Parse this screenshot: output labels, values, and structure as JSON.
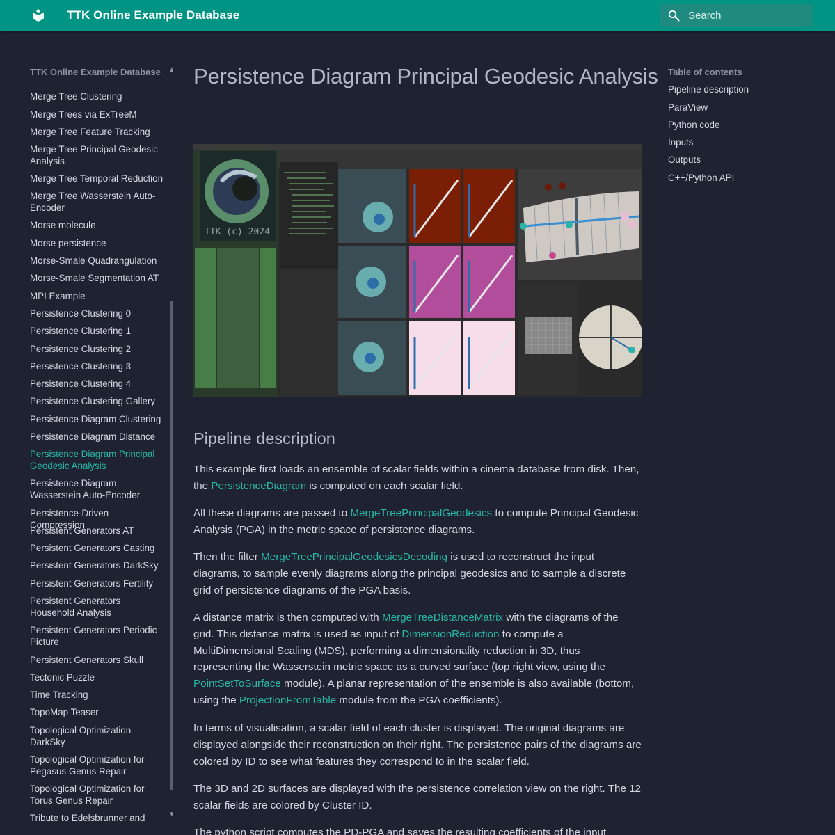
{
  "header": {
    "site_title": "TTK Online Example Database",
    "search_placeholder": "Search"
  },
  "sidebar": {
    "title": "TTK Online Example Database",
    "items": [
      {
        "label": "Merge Tree Clustering"
      },
      {
        "label": "Merge Trees via ExTreeM"
      },
      {
        "label": "Merge Tree Feature Tracking"
      },
      {
        "label": "Merge Tree Principal Geodesic Analysis"
      },
      {
        "label": "Merge Tree Temporal Reduction"
      },
      {
        "label": "Merge Tree Wasserstein Auto-Encoder"
      },
      {
        "label": "Morse molecule"
      },
      {
        "label": "Morse persistence"
      },
      {
        "label": "Morse-Smale Quadrangulation"
      },
      {
        "label": "Morse-Smale Segmentation AT"
      },
      {
        "label": "MPI Example"
      },
      {
        "label": "Persistence Clustering 0"
      },
      {
        "label": "Persistence Clustering 1"
      },
      {
        "label": "Persistence Clustering 2"
      },
      {
        "label": "Persistence Clustering 3"
      },
      {
        "label": "Persistence Clustering 4"
      },
      {
        "label": "Persistence Clustering Gallery"
      },
      {
        "label": "Persistence Diagram Clustering"
      },
      {
        "label": "Persistence Diagram Distance"
      },
      {
        "label": "Persistence Diagram Principal Geodesic Analysis",
        "active": true
      },
      {
        "label": "Persistence Diagram Wasserstein Auto-Encoder"
      },
      {
        "label": "Persistence-Driven Compression"
      },
      {
        "label": "Persistent Generators AT"
      },
      {
        "label": "Persistent Generators Casting"
      },
      {
        "label": "Persistent Generators DarkSky"
      },
      {
        "label": "Persistent Generators Fertility"
      },
      {
        "label": "Persistent Generators Household Analysis"
      },
      {
        "label": "Persistent Generators Periodic Picture"
      },
      {
        "label": "Persistent Generators Skull"
      },
      {
        "label": "Tectonic Puzzle"
      },
      {
        "label": "Time Tracking"
      },
      {
        "label": "TopoMap Teaser"
      },
      {
        "label": "Topological Optimization DarkSky"
      },
      {
        "label": "Topological Optimization for Pegasus Genus Repair"
      },
      {
        "label": "Topological Optimization for Torus Genus Repair"
      },
      {
        "label": "Tribute to Edelsbrunner and"
      }
    ]
  },
  "main": {
    "title": "Persistence Diagram Principal Geodesic Analysis",
    "screenshot_overlay_text": "TTK (c) 2024",
    "section_heading": "Pipeline description",
    "paragraphs": [
      {
        "parts": [
          {
            "t": "This example first loads an ensemble of scalar fields within a cinema database from disk. Then, the "
          },
          {
            "t": "PersistenceDiagram",
            "link": true
          },
          {
            "t": " is computed on each scalar field."
          }
        ]
      },
      {
        "parts": [
          {
            "t": "All these diagrams are passed to "
          },
          {
            "t": "MergeTreePrincipalGeodesics",
            "link": true
          },
          {
            "t": " to compute Principal Geodesic Analysis (PGA) in the metric space of persistence diagrams."
          }
        ]
      },
      {
        "parts": [
          {
            "t": "Then the filter "
          },
          {
            "t": "MergeTreePrincipalGeodesicsDecoding",
            "link": true
          },
          {
            "t": " is used to reconstruct the input diagrams, to sample evenly diagrams along the principal geodesics and to sample a discrete grid of persistence diagrams of the PGA basis."
          }
        ]
      },
      {
        "parts": [
          {
            "t": "A distance matrix is then computed with "
          },
          {
            "t": "MergeTreeDistanceMatrix",
            "link": true
          },
          {
            "t": " with the diagrams of the grid. This distance matrix is used as input of "
          },
          {
            "t": "DimensionReduction",
            "link": true
          },
          {
            "t": " to compute a MultiDimensional Scaling (MDS), performing a dimensionality reduction in 3D, thus representing the Wasserstein metric space as a curved surface (top right view, using the "
          },
          {
            "t": "PointSetToSurface",
            "link": true
          },
          {
            "t": " module). A planar representation of the ensemble is also available (bottom, using the "
          },
          {
            "t": "ProjectionFromTable",
            "link": true
          },
          {
            "t": " module from the PGA coefficients)."
          }
        ]
      },
      {
        "parts": [
          {
            "t": "In terms of visualisation, a scalar field of each cluster is displayed. The original diagrams are displayed alongside their reconstruction on their right. The persistence pairs of the diagrams are colored by ID to see what features they correspond to in the scalar field."
          }
        ]
      },
      {
        "parts": [
          {
            "t": "The 3D and 2D surfaces are displayed with the persistence correlation view on the right. The 12 scalar fields are colored by Cluster ID."
          }
        ]
      },
      {
        "parts": [
          {
            "t": "The python script computes the PD-PGA and saves the resulting coefficients of the input"
          }
        ]
      }
    ]
  },
  "toc": {
    "title": "Table of contents",
    "items": [
      "Pipeline description",
      "ParaView",
      "Python code",
      "Inputs",
      "Outputs",
      "C++/Python API"
    ]
  },
  "colors": {
    "header": "#009485",
    "background": "#1f2230",
    "link": "#27b8a7",
    "text": "#d4d6e0"
  },
  "icons": [
    "ttk-logo-icon",
    "search-icon",
    "chevron-up-icon",
    "chevron-down-icon"
  ]
}
